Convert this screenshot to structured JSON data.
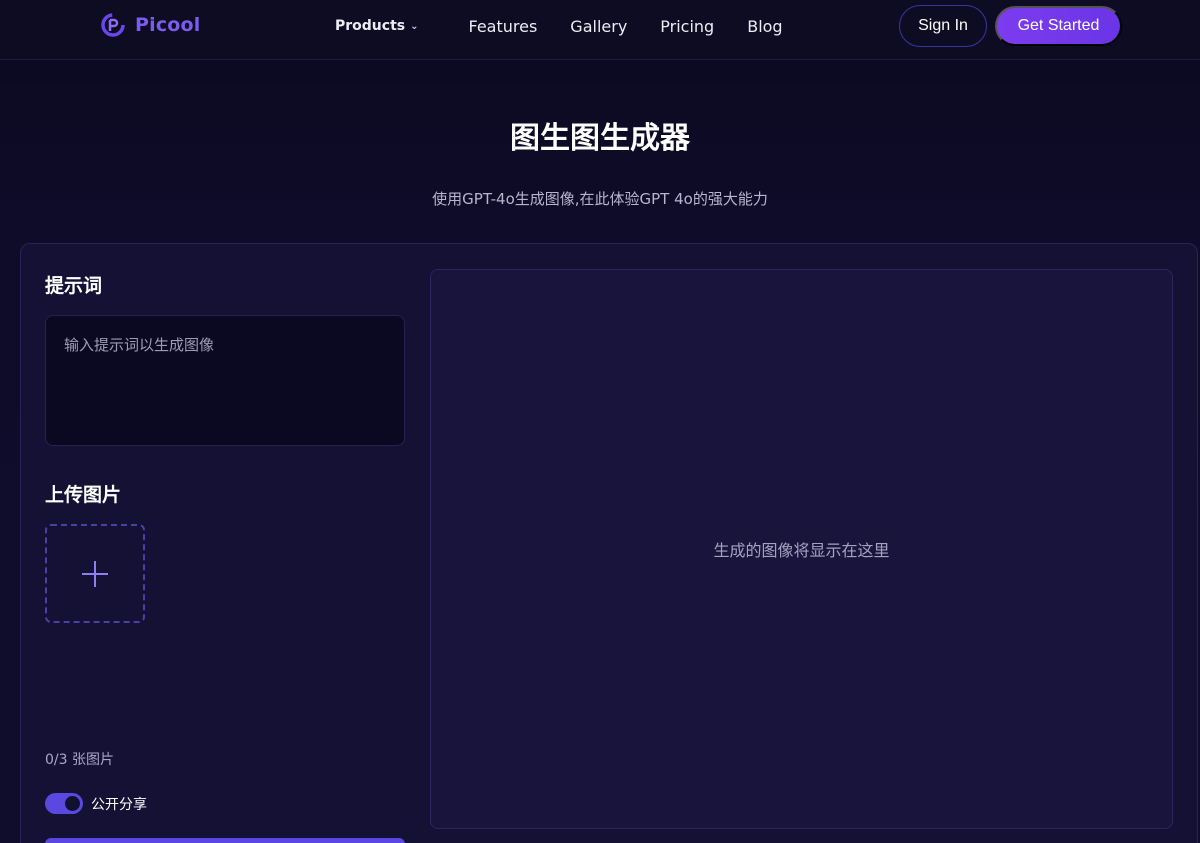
{
  "header": {
    "brand": "Picool",
    "nav": {
      "products": "Products",
      "features": "Features",
      "gallery": "Gallery",
      "pricing": "Pricing",
      "blog": "Blog"
    },
    "sign_in": "Sign In",
    "get_started": "Get Started"
  },
  "hero": {
    "title": "图生图生成器",
    "subtitle": "使用GPT-4o生成图像,在此体验GPT 4o的强大能力"
  },
  "form": {
    "prompt_label": "提示词",
    "prompt_placeholder": "输入提示词以生成图像",
    "upload_label": "上传图片",
    "image_count": "0/3 张图片",
    "public_share_label": "公开分享",
    "public_share_on": true
  },
  "preview": {
    "placeholder": "生成的图像将显示在这里"
  },
  "colors": {
    "brand": "#7b5cf0",
    "accent": "#6a35e6",
    "toggle": "#5a48e0"
  },
  "icons": {
    "logo": "picool-logo-icon",
    "products_chevron": "chevron-down-icon",
    "upload": "plus-icon"
  }
}
